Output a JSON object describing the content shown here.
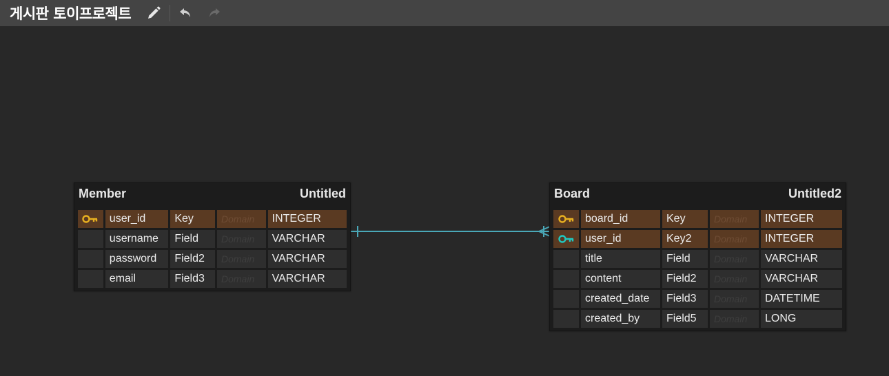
{
  "header": {
    "title": "게시판 토이프로젝트",
    "edit_icon": "pencil-icon",
    "undo_icon": "undo-icon",
    "redo_icon": "redo-icon"
  },
  "colors": {
    "topbar": "#444444",
    "canvas": "#282828",
    "pk_row": "#5a3a22",
    "pk_key": "#e8b020",
    "fk_key": "#20c8c0",
    "relationship": "#4aa8b8"
  },
  "tables": {
    "member": {
      "name": "Member",
      "logical_name": "Untitled",
      "rows": [
        {
          "icon": "primary-key-icon",
          "column": "user_id",
          "logical": "Key",
          "domain": "Domain",
          "type": "INTEGER",
          "kind": "pk"
        },
        {
          "icon": "",
          "column": "username",
          "logical": "Field",
          "domain": "Domain",
          "type": "VARCHAR",
          "kind": "normal"
        },
        {
          "icon": "",
          "column": "password",
          "logical": "Field2",
          "domain": "Domain",
          "type": "VARCHAR",
          "kind": "normal"
        },
        {
          "icon": "",
          "column": "email",
          "logical": "Field3",
          "domain": "Domain",
          "type": "VARCHAR",
          "kind": "normal"
        }
      ]
    },
    "board": {
      "name": "Board",
      "logical_name": "Untitled2",
      "rows": [
        {
          "icon": "primary-key-icon",
          "column": "board_id",
          "logical": "Key",
          "domain": "Domain",
          "type": "INTEGER",
          "kind": "pk"
        },
        {
          "icon": "foreign-key-icon",
          "column": "user_id",
          "logical": "Key2",
          "domain": "Domain",
          "type": "INTEGER",
          "kind": "fk"
        },
        {
          "icon": "",
          "column": "title",
          "logical": "Field",
          "domain": "Domain",
          "type": "VARCHAR",
          "kind": "normal"
        },
        {
          "icon": "",
          "column": "content",
          "logical": "Field2",
          "domain": "Domain",
          "type": "VARCHAR",
          "kind": "normal"
        },
        {
          "icon": "",
          "column": "created_date",
          "logical": "Field3",
          "domain": "Domain",
          "type": "DATETIME",
          "kind": "normal"
        },
        {
          "icon": "",
          "column": "created_by",
          "logical": "Field5",
          "domain": "Domain",
          "type": "LONG",
          "kind": "normal"
        }
      ]
    }
  },
  "relationship": {
    "from": "Member",
    "to": "Board",
    "from_cardinality": "one",
    "to_cardinality": "many"
  }
}
